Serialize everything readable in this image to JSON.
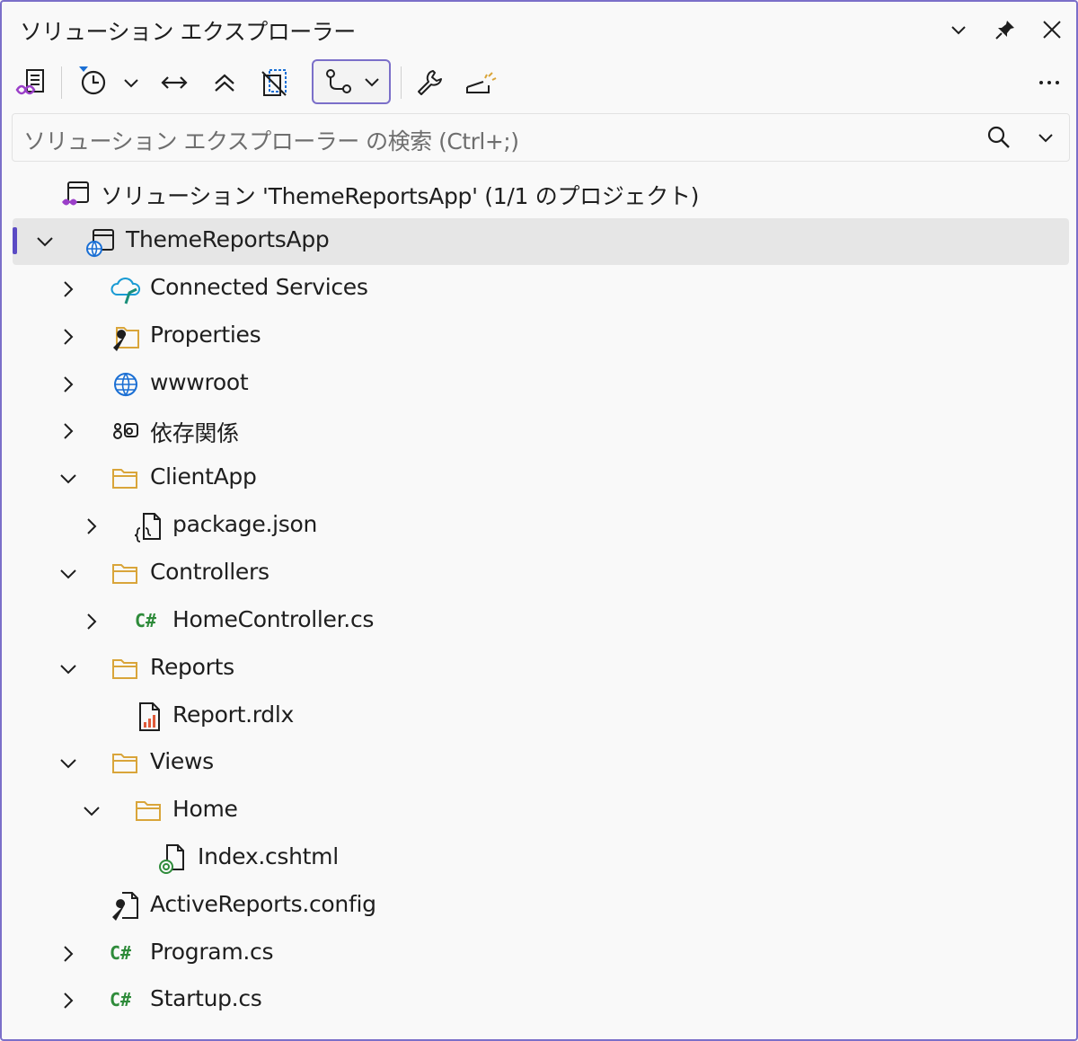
{
  "panel": {
    "title": "ソリューション エクスプローラー"
  },
  "search": {
    "placeholder": "ソリューション エクスプローラー の検索 (Ctrl+;)"
  },
  "tree": {
    "solution": "ソリューション 'ThemeReportsApp' (1/1 のプロジェクト)",
    "project": "ThemeReportsApp",
    "items": [
      {
        "label": "Connected Services"
      },
      {
        "label": "Properties"
      },
      {
        "label": "wwwroot"
      },
      {
        "label": "依存関係"
      },
      {
        "label": "ClientApp"
      },
      {
        "label": "package.json"
      },
      {
        "label": "Controllers"
      },
      {
        "label": "HomeController.cs"
      },
      {
        "label": "Reports"
      },
      {
        "label": "Report.rdlx"
      },
      {
        "label": "Views"
      },
      {
        "label": "Home"
      },
      {
        "label": "Index.cshtml"
      },
      {
        "label": "ActiveReports.config"
      },
      {
        "label": "Program.cs"
      },
      {
        "label": "Startup.cs"
      }
    ],
    "csharp_glyph": "C#"
  },
  "colors": {
    "accent": "#5b4bc4",
    "folder": "#d9a53a",
    "csharp": "#2e8b3a",
    "selected_row": "#e6e6e6"
  }
}
